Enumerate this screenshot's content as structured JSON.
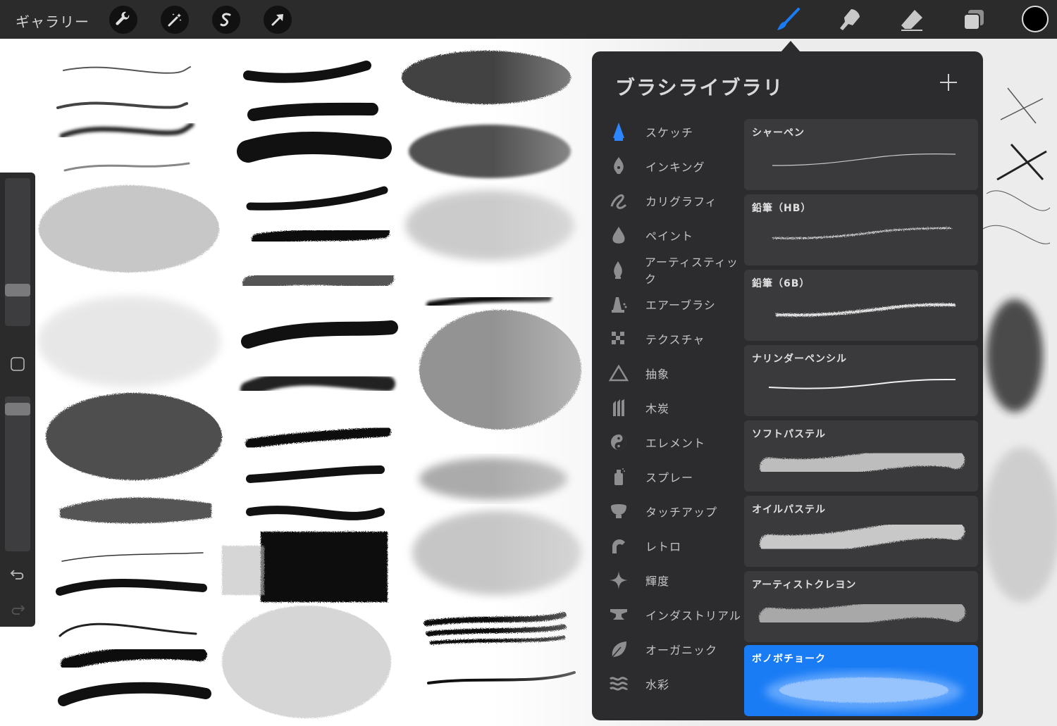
{
  "topbar": {
    "gallery_label": "ギャラリー"
  },
  "library": {
    "title": "ブラシライブラリ",
    "categories": [
      {
        "label": "スケッチ",
        "icon": "sketch-icon"
      },
      {
        "label": "インキング",
        "icon": "inking-icon"
      },
      {
        "label": "カリグラフィ",
        "icon": "calligraphy-icon"
      },
      {
        "label": "ペイント",
        "icon": "paint-icon"
      },
      {
        "label": "アーティスティック",
        "icon": "artistic-icon"
      },
      {
        "label": "エアーブラシ",
        "icon": "airbrush-icon"
      },
      {
        "label": "テクスチャ",
        "icon": "texture-icon"
      },
      {
        "label": "抽象",
        "icon": "abstract-icon"
      },
      {
        "label": "木炭",
        "icon": "charcoal-icon"
      },
      {
        "label": "エレメント",
        "icon": "elements-icon"
      },
      {
        "label": "スプレー",
        "icon": "spray-icon"
      },
      {
        "label": "タッチアップ",
        "icon": "touchup-icon"
      },
      {
        "label": "レトロ",
        "icon": "retro-icon"
      },
      {
        "label": "輝度",
        "icon": "luminance-icon"
      },
      {
        "label": "インダストリアル",
        "icon": "industrial-icon"
      },
      {
        "label": "オーガニック",
        "icon": "organic-icon"
      },
      {
        "label": "水彩",
        "icon": "watercolor-icon"
      }
    ],
    "brushes": [
      {
        "name": "シャーペン",
        "selected": false
      },
      {
        "name": "鉛筆（HB）",
        "selected": false
      },
      {
        "name": "鉛筆（6B）",
        "selected": false
      },
      {
        "name": "ナリンダーペンシル",
        "selected": false
      },
      {
        "name": "ソフトパステル",
        "selected": false
      },
      {
        "name": "オイルパステル",
        "selected": false
      },
      {
        "name": "アーティストクレヨン",
        "selected": false
      },
      {
        "name": "ボノボチョーク",
        "selected": true
      }
    ]
  },
  "colors": {
    "toolbar_bg": "#2b2b2c",
    "panel_bg": "#2c2c2e",
    "accent": "#1a7cf5",
    "current_color": "#000000"
  }
}
